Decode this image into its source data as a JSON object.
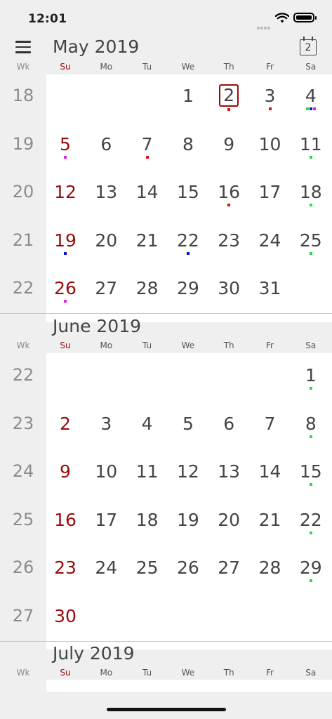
{
  "status": {
    "time": "12:01"
  },
  "header": {
    "today_icon_number": "2"
  },
  "weekday_labels": {
    "wk": "Wk",
    "days": [
      "Su",
      "Mo",
      "Tu",
      "We",
      "Th",
      "Fr",
      "Sa"
    ]
  },
  "colors": {
    "sunday": "#9b0a0a",
    "red": "#e01010",
    "green": "#22dd44",
    "blue": "#1010dd",
    "magenta": "#e020e0"
  },
  "months": [
    {
      "title": "May 2019",
      "weeks": [
        {
          "wk": "18",
          "days": [
            "",
            "",
            "",
            "1",
            "2",
            "3",
            "4"
          ]
        },
        {
          "wk": "19",
          "days": [
            "5",
            "6",
            "7",
            "8",
            "9",
            "10",
            "11"
          ]
        },
        {
          "wk": "20",
          "days": [
            "12",
            "13",
            "14",
            "15",
            "16",
            "17",
            "18"
          ]
        },
        {
          "wk": "21",
          "days": [
            "19",
            "20",
            "21",
            "22",
            "23",
            "24",
            "25"
          ]
        },
        {
          "wk": "22",
          "days": [
            "26",
            "27",
            "28",
            "29",
            "30",
            "31",
            ""
          ]
        }
      ]
    },
    {
      "title": "June 2019",
      "weeks": [
        {
          "wk": "22",
          "days": [
            "",
            "",
            "",
            "",
            "",
            "",
            "1"
          ]
        },
        {
          "wk": "23",
          "days": [
            "2",
            "3",
            "4",
            "5",
            "6",
            "7",
            "8"
          ]
        },
        {
          "wk": "24",
          "days": [
            "9",
            "10",
            "11",
            "12",
            "13",
            "14",
            "15"
          ]
        },
        {
          "wk": "25",
          "days": [
            "16",
            "17",
            "18",
            "19",
            "20",
            "21",
            "22"
          ]
        },
        {
          "wk": "26",
          "days": [
            "23",
            "24",
            "25",
            "26",
            "27",
            "28",
            "29"
          ]
        },
        {
          "wk": "27",
          "days": [
            "30",
            "",
            "",
            "",
            "",
            "",
            ""
          ]
        }
      ]
    },
    {
      "title": "July 2019",
      "weeks": []
    }
  ],
  "today": {
    "month": 0,
    "day": "2"
  },
  "event_dots": {
    "0": {
      "2": [
        "red"
      ],
      "3": [
        "red"
      ],
      "4": [
        "green",
        "blue",
        "magenta"
      ],
      "5": [
        "magenta"
      ],
      "7": [
        "red"
      ],
      "11": [
        "green"
      ],
      "16": [
        "red"
      ],
      "18": [
        "green"
      ],
      "19": [
        "blue"
      ],
      "22": [
        "blue"
      ],
      "25": [
        "green"
      ],
      "26": [
        "magenta"
      ]
    },
    "1": {
      "1": [
        "green"
      ],
      "8": [
        "green"
      ],
      "15": [
        "green"
      ],
      "22": [
        "green"
      ],
      "29": [
        "green"
      ]
    }
  }
}
